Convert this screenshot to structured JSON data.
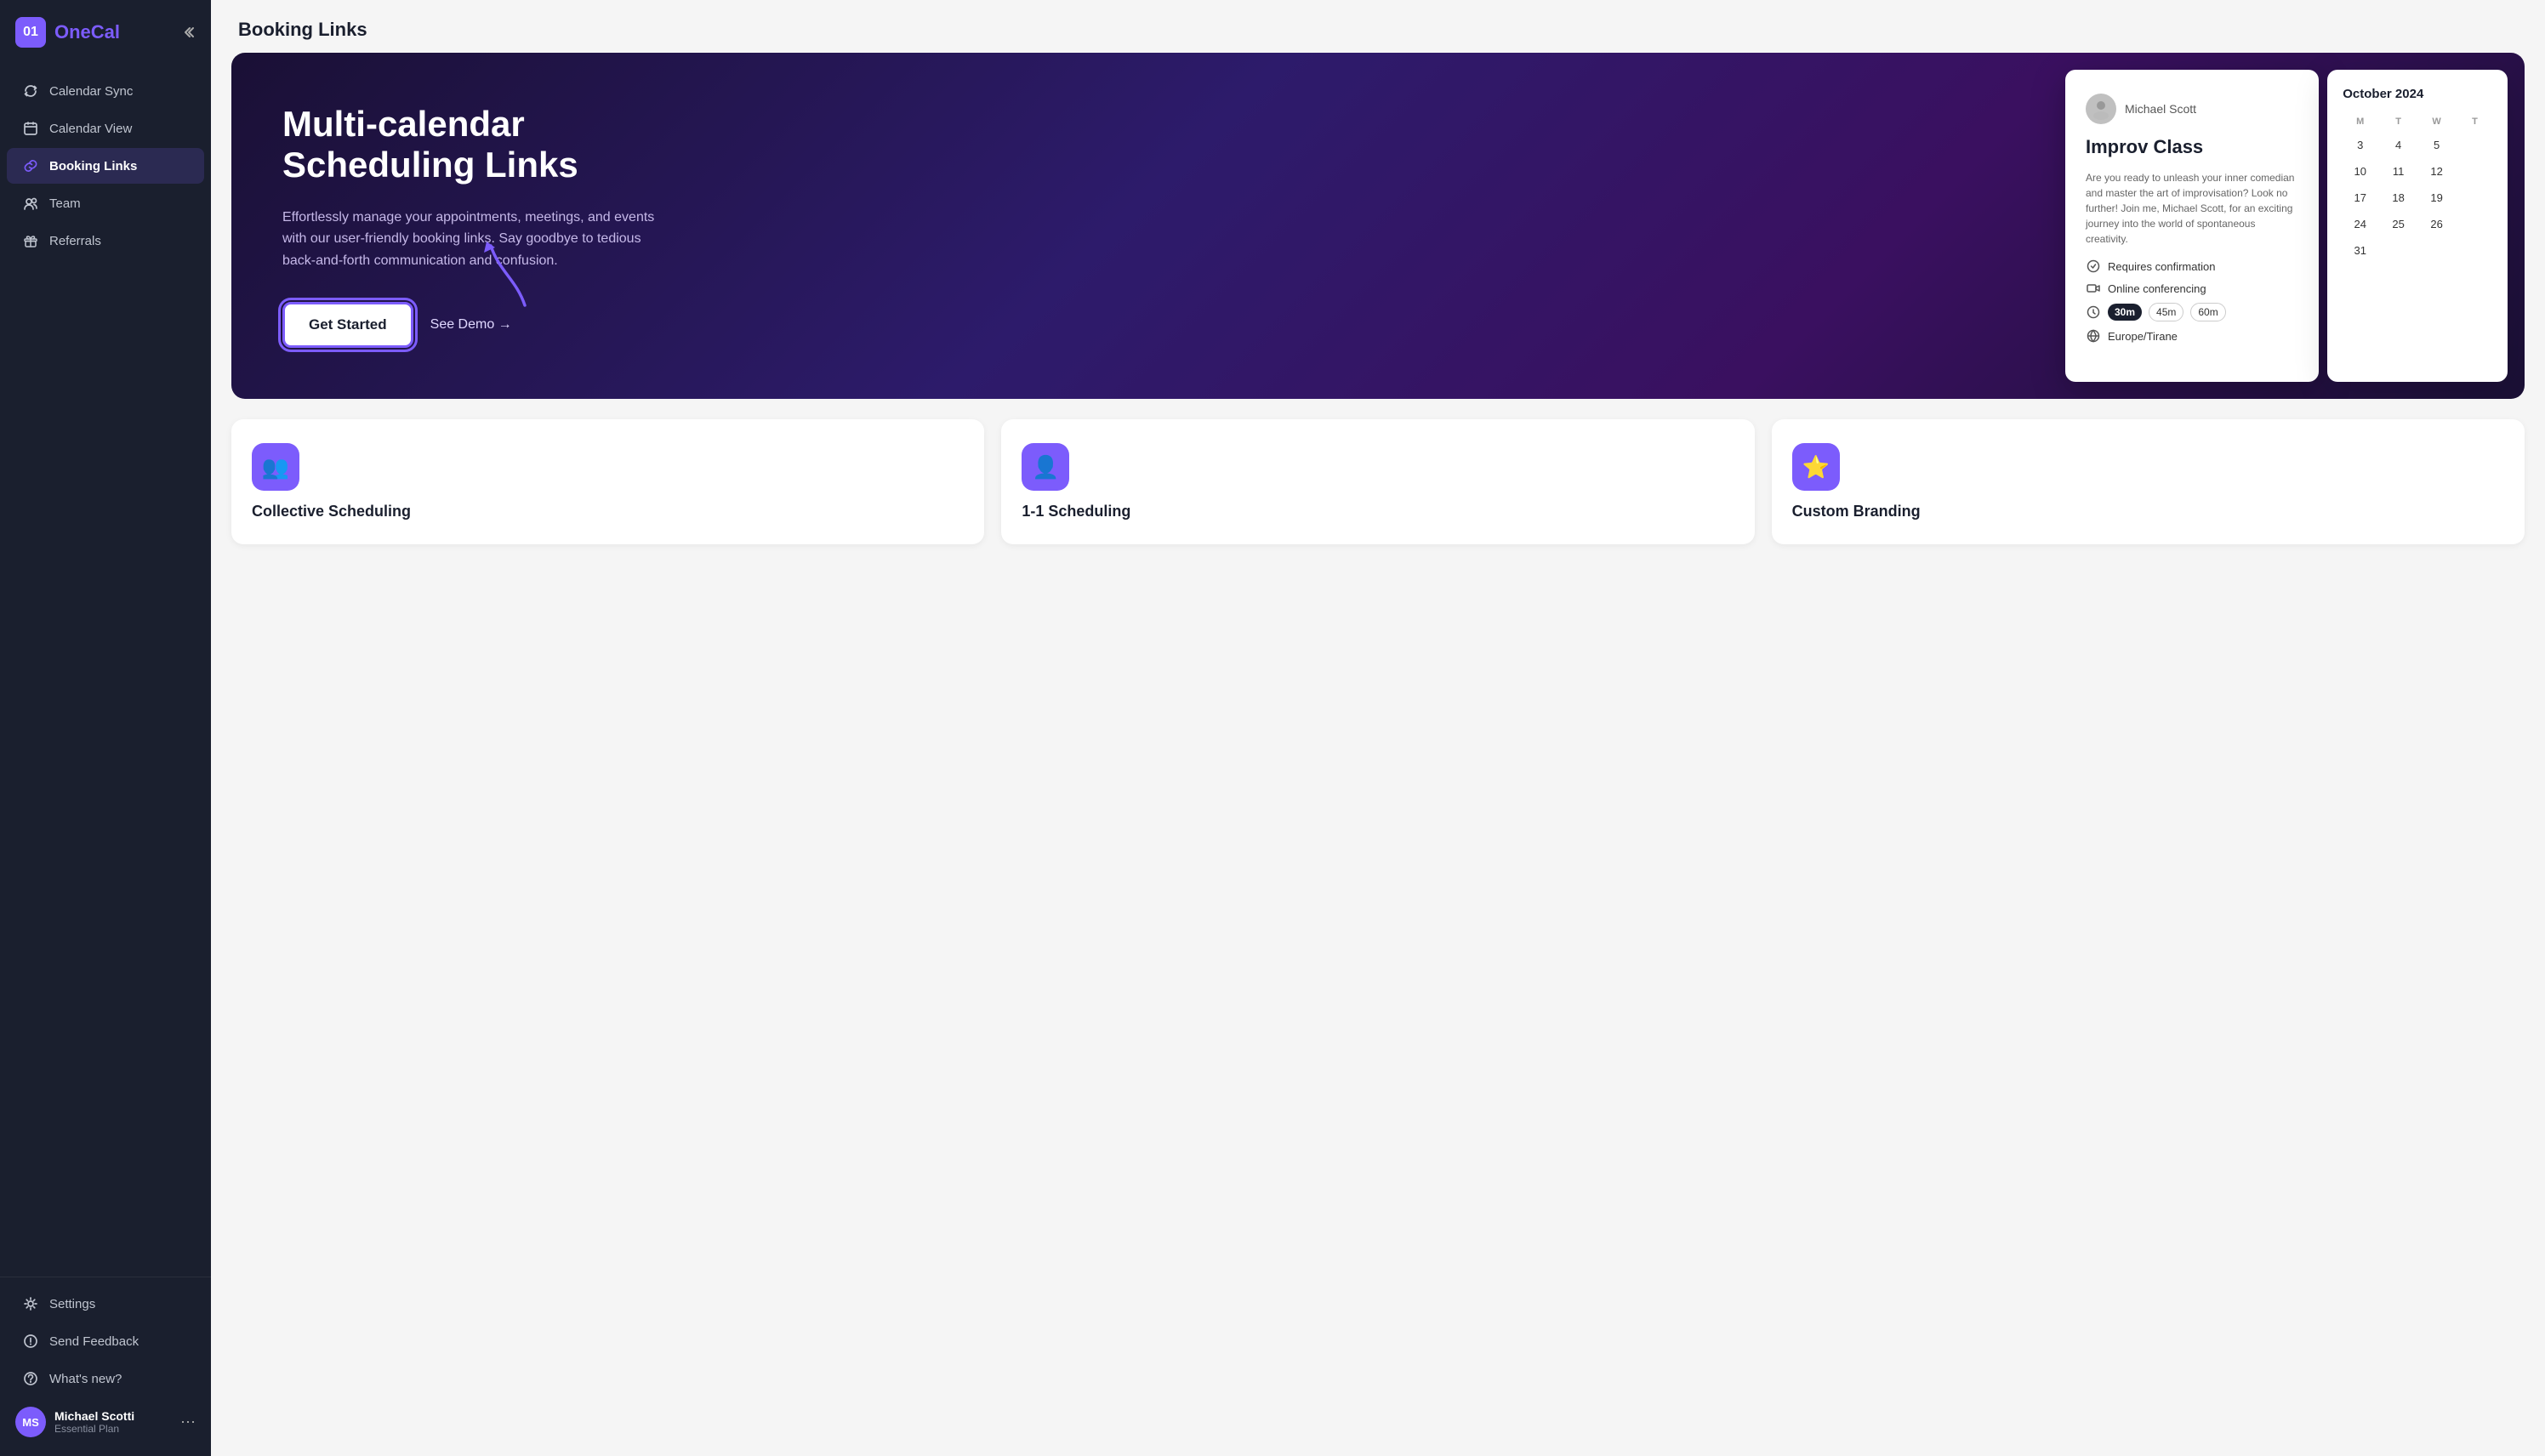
{
  "app": {
    "logo_number": "01",
    "logo_name_one": "One",
    "logo_name_two": "Cal"
  },
  "sidebar": {
    "collapse_label": "Collapse",
    "items": [
      {
        "id": "calendar-sync",
        "label": "Calendar Sync",
        "icon": "sync-icon"
      },
      {
        "id": "calendar-view",
        "label": "Calendar View",
        "icon": "calendar-icon"
      },
      {
        "id": "booking-links",
        "label": "Booking Links",
        "icon": "link-icon",
        "active": true
      },
      {
        "id": "team",
        "label": "Team",
        "icon": "team-icon"
      },
      {
        "id": "referrals",
        "label": "Referrals",
        "icon": "gift-icon"
      }
    ],
    "bottom_items": [
      {
        "id": "settings",
        "label": "Settings",
        "icon": "settings-icon"
      },
      {
        "id": "send-feedback",
        "label": "Send Feedback",
        "icon": "feedback-icon"
      },
      {
        "id": "whats-new",
        "label": "What's new?",
        "icon": "help-icon"
      }
    ],
    "user": {
      "name": "Michael Scotti",
      "plan": "Essential Plan",
      "initials": "MS"
    }
  },
  "page": {
    "title": "Booking Links"
  },
  "hero": {
    "title_line1": "Multi-calendar",
    "title_line2": "Scheduling Links",
    "description": "Effortlessly manage your appointments, meetings, and events with our user-friendly booking links. Say goodbye to tedious back-and-forth communication and confusion.",
    "cta_label": "Get Started",
    "demo_label": "See Demo →"
  },
  "preview_card": {
    "username": "Michael Scott",
    "avatar_emoji": "👤",
    "event_title": "Improv Class",
    "description": "Are you ready to unleash your inner comedian and master the art of improvisation? Look no further! Join me, Michael Scott, for an exciting journey into the world of spontaneous creativity.",
    "requires_confirmation": "Requires confirmation",
    "online_conferencing": "Online conferencing",
    "durations": [
      "30m",
      "45m",
      "60m"
    ],
    "selected_duration": "30m",
    "timezone": "Europe/Tirane"
  },
  "calendar": {
    "month": "October 2024",
    "headers": [
      "M",
      "T",
      "W",
      "T"
    ],
    "weeks": [
      [
        3,
        4,
        5,
        ""
      ],
      [
        10,
        11,
        12,
        ""
      ],
      [
        17,
        18,
        19,
        ""
      ],
      [
        24,
        25,
        26,
        ""
      ],
      [
        31,
        "",
        "",
        ""
      ]
    ]
  },
  "features": [
    {
      "id": "collective",
      "icon": "👥",
      "title": "Collective Scheduling"
    },
    {
      "id": "one-on-one",
      "icon": "👤",
      "title": "1-1 Scheduling"
    },
    {
      "id": "custom-branding",
      "icon": "⭐",
      "title": "Custom Branding"
    }
  ],
  "colors": {
    "accent": "#7c5cfc",
    "dark": "#1a1f2e",
    "arrow": "#7c5cfc"
  }
}
